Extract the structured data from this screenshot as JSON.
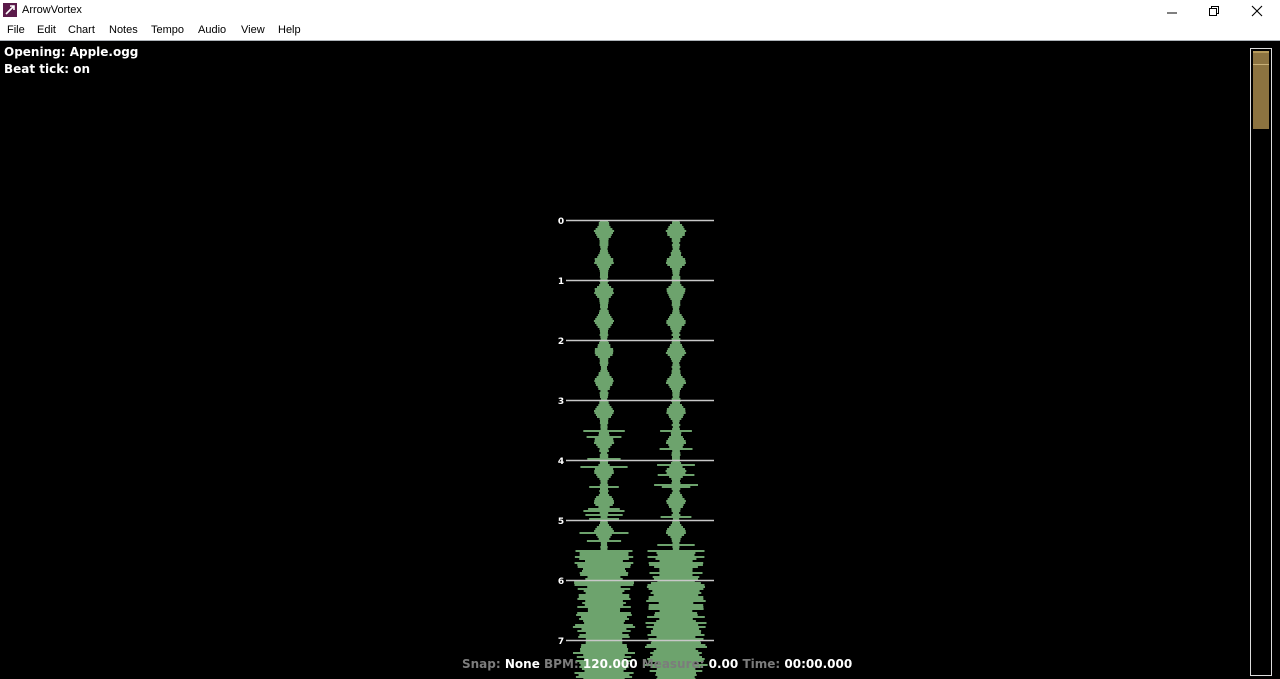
{
  "window": {
    "title": "ArrowVortex",
    "controls": [
      "minimize-icon",
      "restore-icon",
      "close-icon"
    ]
  },
  "menu": [
    "File",
    "Edit",
    "Chart",
    "Notes",
    "Tempo",
    "Audio",
    "View",
    "Help"
  ],
  "info": {
    "line1": "Opening: Apple.ogg",
    "line2": "Beat tick: on"
  },
  "measures": [
    "0",
    "1",
    "2",
    "3",
    "4",
    "5",
    "6",
    "7"
  ],
  "status": {
    "snap_label": "Snap:",
    "snap_value": "None",
    "bpm_label": "BPM:",
    "bpm_value": "120.000",
    "measure_label": "Measure:",
    "measure_value": "0.00",
    "time_label": "Time:",
    "time_value": "00:00.000"
  },
  "colors": {
    "waveform": "#6da36d",
    "measure_line": "#c8c8c8",
    "scroll_thumb": "#8c7340"
  }
}
